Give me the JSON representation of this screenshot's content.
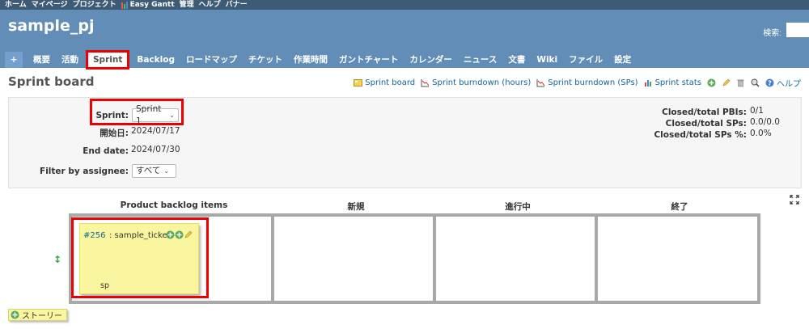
{
  "top_menu": {
    "items": [
      "ホーム",
      "マイページ",
      "プロジェクト",
      "Easy Gantt",
      "管理",
      "ヘルプ",
      "バナー"
    ]
  },
  "header": {
    "project_title": "sample_pj",
    "search_label": "検索:"
  },
  "main_menu": {
    "tabs": [
      {
        "label": "+"
      },
      {
        "label": "概要"
      },
      {
        "label": "活動"
      },
      {
        "label": "Sprint",
        "selected": true
      },
      {
        "label": "Backlog"
      },
      {
        "label": "ロードマップ"
      },
      {
        "label": "チケット"
      },
      {
        "label": "作業時間"
      },
      {
        "label": "ガントチャート"
      },
      {
        "label": "カレンダー"
      },
      {
        "label": "ニュース"
      },
      {
        "label": "文書"
      },
      {
        "label": "Wiki"
      },
      {
        "label": "ファイル"
      },
      {
        "label": "設定"
      }
    ]
  },
  "page": {
    "title": "Sprint board"
  },
  "contextual": {
    "sprint_board": "Sprint board",
    "burndown_hours": "Sprint burndown (hours)",
    "burndown_sps": "Sprint burndown (SPs)",
    "sprint_stats": "Sprint stats",
    "help": "ヘルプ"
  },
  "sprint_info": {
    "sprint_label": "Sprint:",
    "sprint_value": "Sprint 1",
    "start_label": "開始日:",
    "start_value": "2024/07/17",
    "end_label": "End date:",
    "end_value": "2024/07/30",
    "assignee_label": "Filter by assignee:",
    "assignee_value": "すべて",
    "closed_pbis_label": "Closed/total PBIs:",
    "closed_pbis_value": "0/1",
    "closed_sps_label": "Closed/total SPs:",
    "closed_sps_value": "0.0/0.0",
    "closed_sps_pct_label": "Closed/total SPs %:",
    "closed_sps_pct_value": "0.0%"
  },
  "board": {
    "columns": [
      "Product backlog items",
      "新規",
      "進行中",
      "終了"
    ],
    "story": {
      "id": "#256",
      "title": ": sample_ticket",
      "sp": "sp"
    }
  },
  "new_story_button": "ストーリー",
  "colors": {
    "header_bg": "#628db6",
    "top_menu_bg": "#3e5b76",
    "highlight": "#e00000",
    "card_bg": "#faf6a0",
    "link": "#116699"
  }
}
